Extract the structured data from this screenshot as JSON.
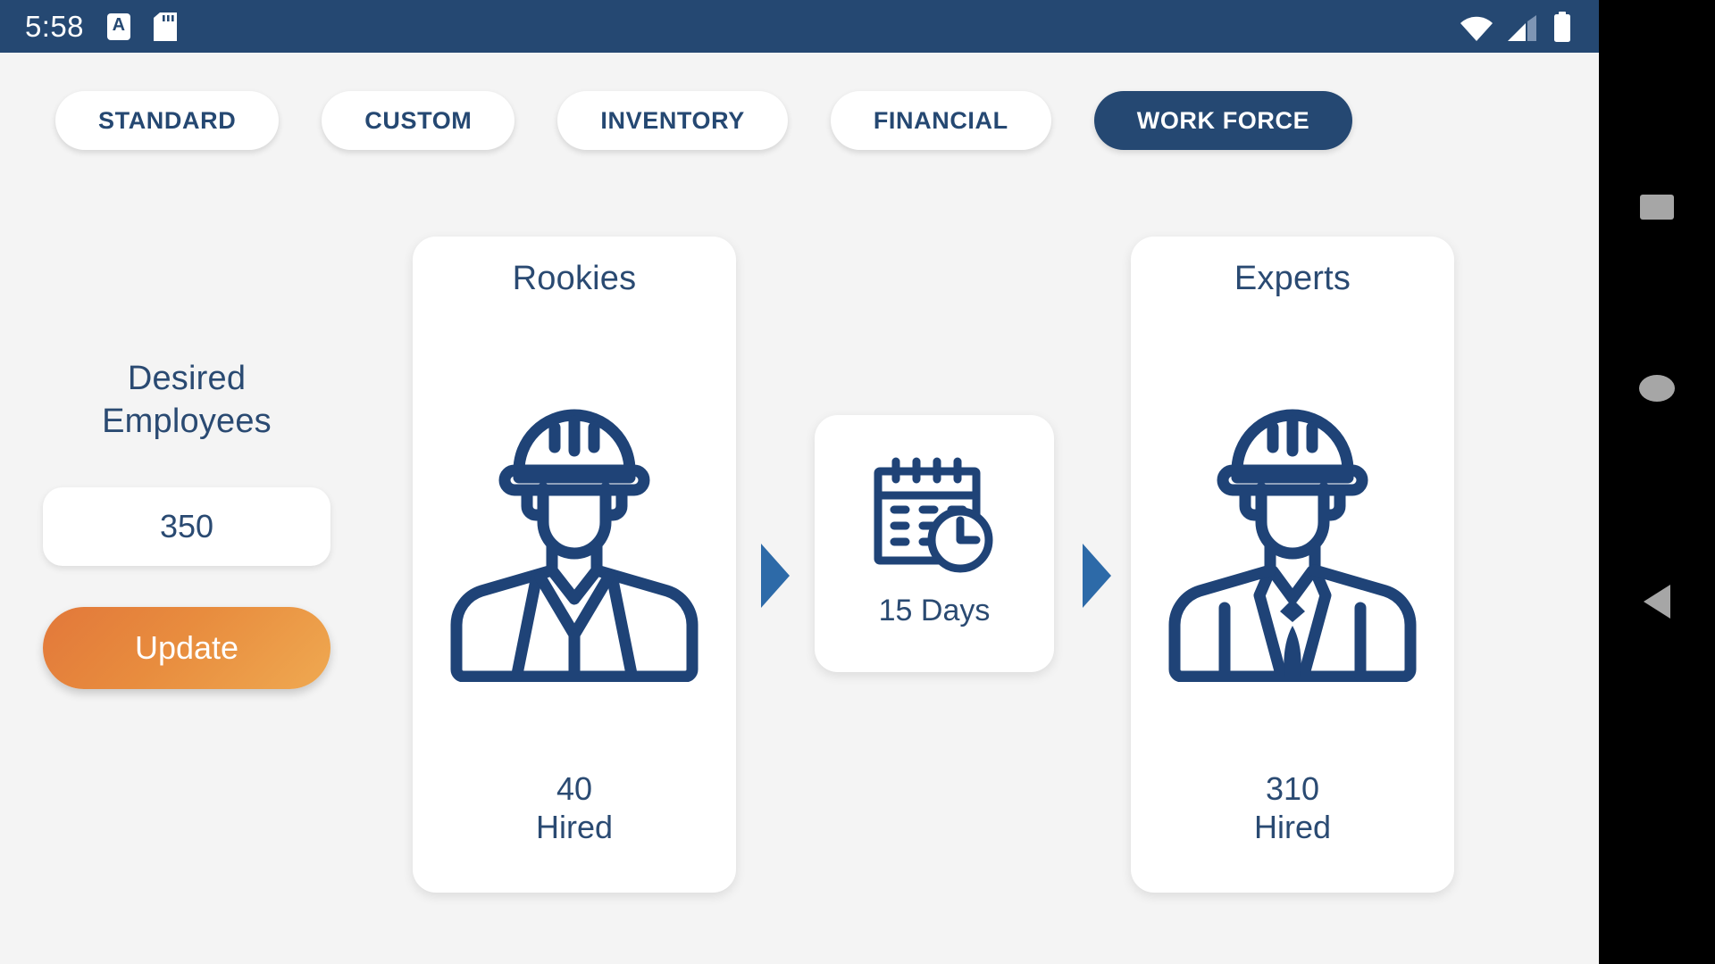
{
  "statusbar": {
    "time": "5:58",
    "icons_left": [
      {
        "name": "notification-a-icon",
        "glyph": "A"
      },
      {
        "name": "sd-card-icon"
      }
    ],
    "icons_right": [
      {
        "name": "wifi-icon"
      },
      {
        "name": "cellular-signal-icon"
      },
      {
        "name": "battery-icon"
      }
    ]
  },
  "tabs": [
    {
      "label": "STANDARD",
      "active": false
    },
    {
      "label": "CUSTOM",
      "active": false
    },
    {
      "label": "INVENTORY",
      "active": false
    },
    {
      "label": "FINANCIAL",
      "active": false
    },
    {
      "label": "WORK FORCE",
      "active": true
    }
  ],
  "control": {
    "label_line1": "Desired",
    "label_line2": "Employees",
    "input_value": "350",
    "input_placeholder": "350",
    "update_label": "Update"
  },
  "flow": {
    "rookies": {
      "title": "Rookies",
      "icon": "construction-worker-vest-icon",
      "count": "40",
      "count_suffix": "Hired"
    },
    "duration": {
      "icon": "calendar-clock-icon",
      "label": "15 Days"
    },
    "experts": {
      "title": "Experts",
      "icon": "construction-worker-suit-icon",
      "count": "310",
      "count_suffix": "Hired"
    },
    "arrow_icon": "arrow-right-icon"
  },
  "navbar": {
    "recent_label": "recent-apps",
    "home_label": "home",
    "back_label": "back"
  },
  "colors": {
    "navy": "#254872",
    "text_navy": "#2a4a72",
    "accent_orange": "#e88c3e",
    "arrow_blue": "#2d6aa8",
    "background": "#f4f4f4",
    "card": "#ffffff",
    "navbar": "#000000"
  }
}
